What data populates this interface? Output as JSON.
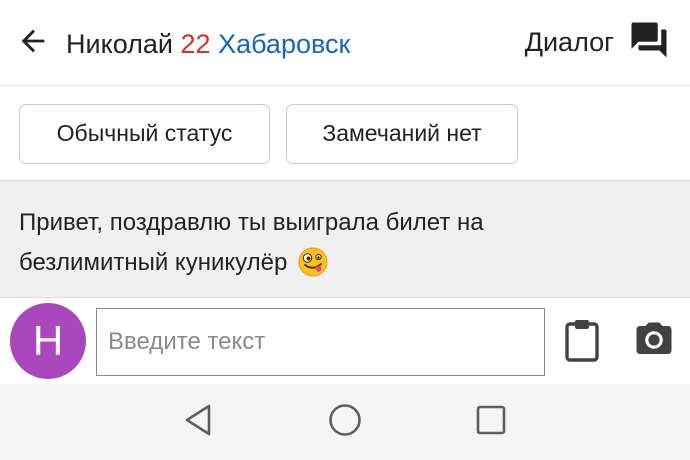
{
  "header": {
    "name": "Николай",
    "age": "22",
    "city": "Хабаровск",
    "dialog_label": "Диалог",
    "back_icon": "arrow-back-icon",
    "dialog_icon": "forum-icon"
  },
  "chips": [
    {
      "label": "Обычный статус"
    },
    {
      "label": "Замечаний нет"
    }
  ],
  "message": {
    "text": "Привет, поздравлю ты выиграла билет на безлимитный куникулёр",
    "emoji_icon": "zany-face-emoji"
  },
  "composer": {
    "avatar_letter": "Н",
    "placeholder": "Введите текст",
    "value": "",
    "clipboard_icon": "clipboard-icon",
    "camera_icon": "camera-icon"
  },
  "colors": {
    "age": "#d32f2f",
    "city": "#1565c0",
    "avatar": "#ab47bc",
    "message_background": "#f0f0f0"
  },
  "navbar": {
    "icons": [
      "nav-back-icon",
      "nav-home-icon",
      "nav-recent-icon"
    ]
  }
}
